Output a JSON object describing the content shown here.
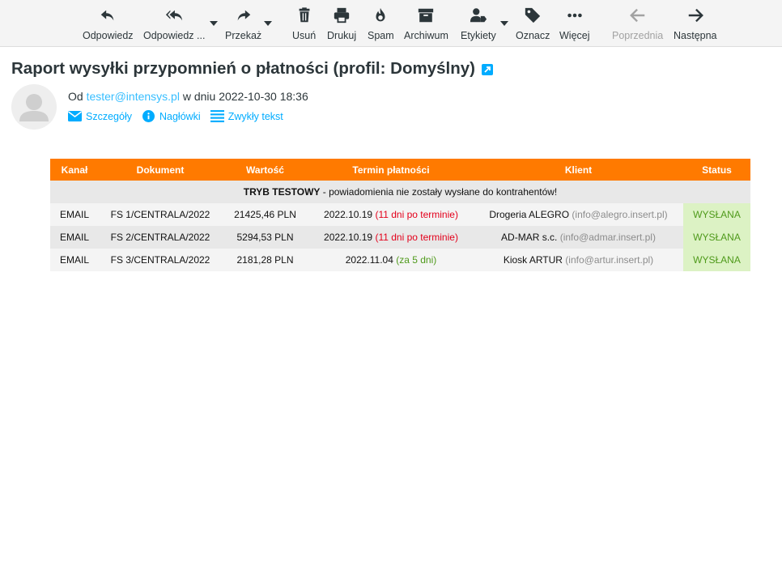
{
  "toolbar": {
    "reply": "Odpowiedz",
    "reply_all": "Odpowiedz ...",
    "forward": "Przekaż",
    "delete": "Usuń",
    "print": "Drukuj",
    "spam": "Spam",
    "archive": "Archiwum",
    "labels": "Etykiety",
    "mark": "Oznacz",
    "more": "Więcej",
    "previous": "Poprzednia",
    "next": "Następna"
  },
  "message": {
    "subject": "Raport wysyłki przypomnień o płatności (profil: Domyślny)",
    "from_prefix": "Od",
    "from_email": "tester@intensys.pl",
    "date_prefix": "w dniu",
    "date": "2022-10-30 18:36"
  },
  "header_links": {
    "details": "Szczegóły",
    "headers": "Nagłówki",
    "plain_text": "Zwykły tekst"
  },
  "report": {
    "columns": [
      "Kanał",
      "Dokument",
      "Wartość",
      "Termin płatności",
      "Klient",
      "Status"
    ],
    "note_bold": "TRYB TESTOWY",
    "note_text": " - powiadomienia nie zostały wysłane do kontrahentów!",
    "rows": [
      {
        "channel": "EMAIL",
        "document": "FS 1/CENTRALA/2022",
        "value": "21425,46 PLN",
        "due_date": "2022.10.19",
        "due_note": "(11 dni po terminie)",
        "due_state": "overdue",
        "client": "Drogeria ALEGRO",
        "client_email": "(info@alegro.insert.pl)",
        "status": "WYSŁANA"
      },
      {
        "channel": "EMAIL",
        "document": "FS 2/CENTRALA/2022",
        "value": "5294,53 PLN",
        "due_date": "2022.10.19",
        "due_note": "(11 dni po terminie)",
        "due_state": "overdue",
        "client": "AD-MAR s.c.",
        "client_email": "(info@admar.insert.pl)",
        "status": "WYSŁANA"
      },
      {
        "channel": "EMAIL",
        "document": "FS 3/CENTRALA/2022",
        "value": "2181,28 PLN",
        "due_date": "2022.11.04",
        "due_note": "(za 5 dni)",
        "due_state": "upcoming",
        "client": "Kiosk ARTUR",
        "client_email": "(info@artur.insert.pl)",
        "status": "WYSŁANA"
      }
    ]
  },
  "colors": {
    "accent": "#00acff",
    "table_header": "#ff7a00",
    "overdue": "#e3001b",
    "ok": "#4f9a1b",
    "status_bg": "#dcf2c4"
  }
}
